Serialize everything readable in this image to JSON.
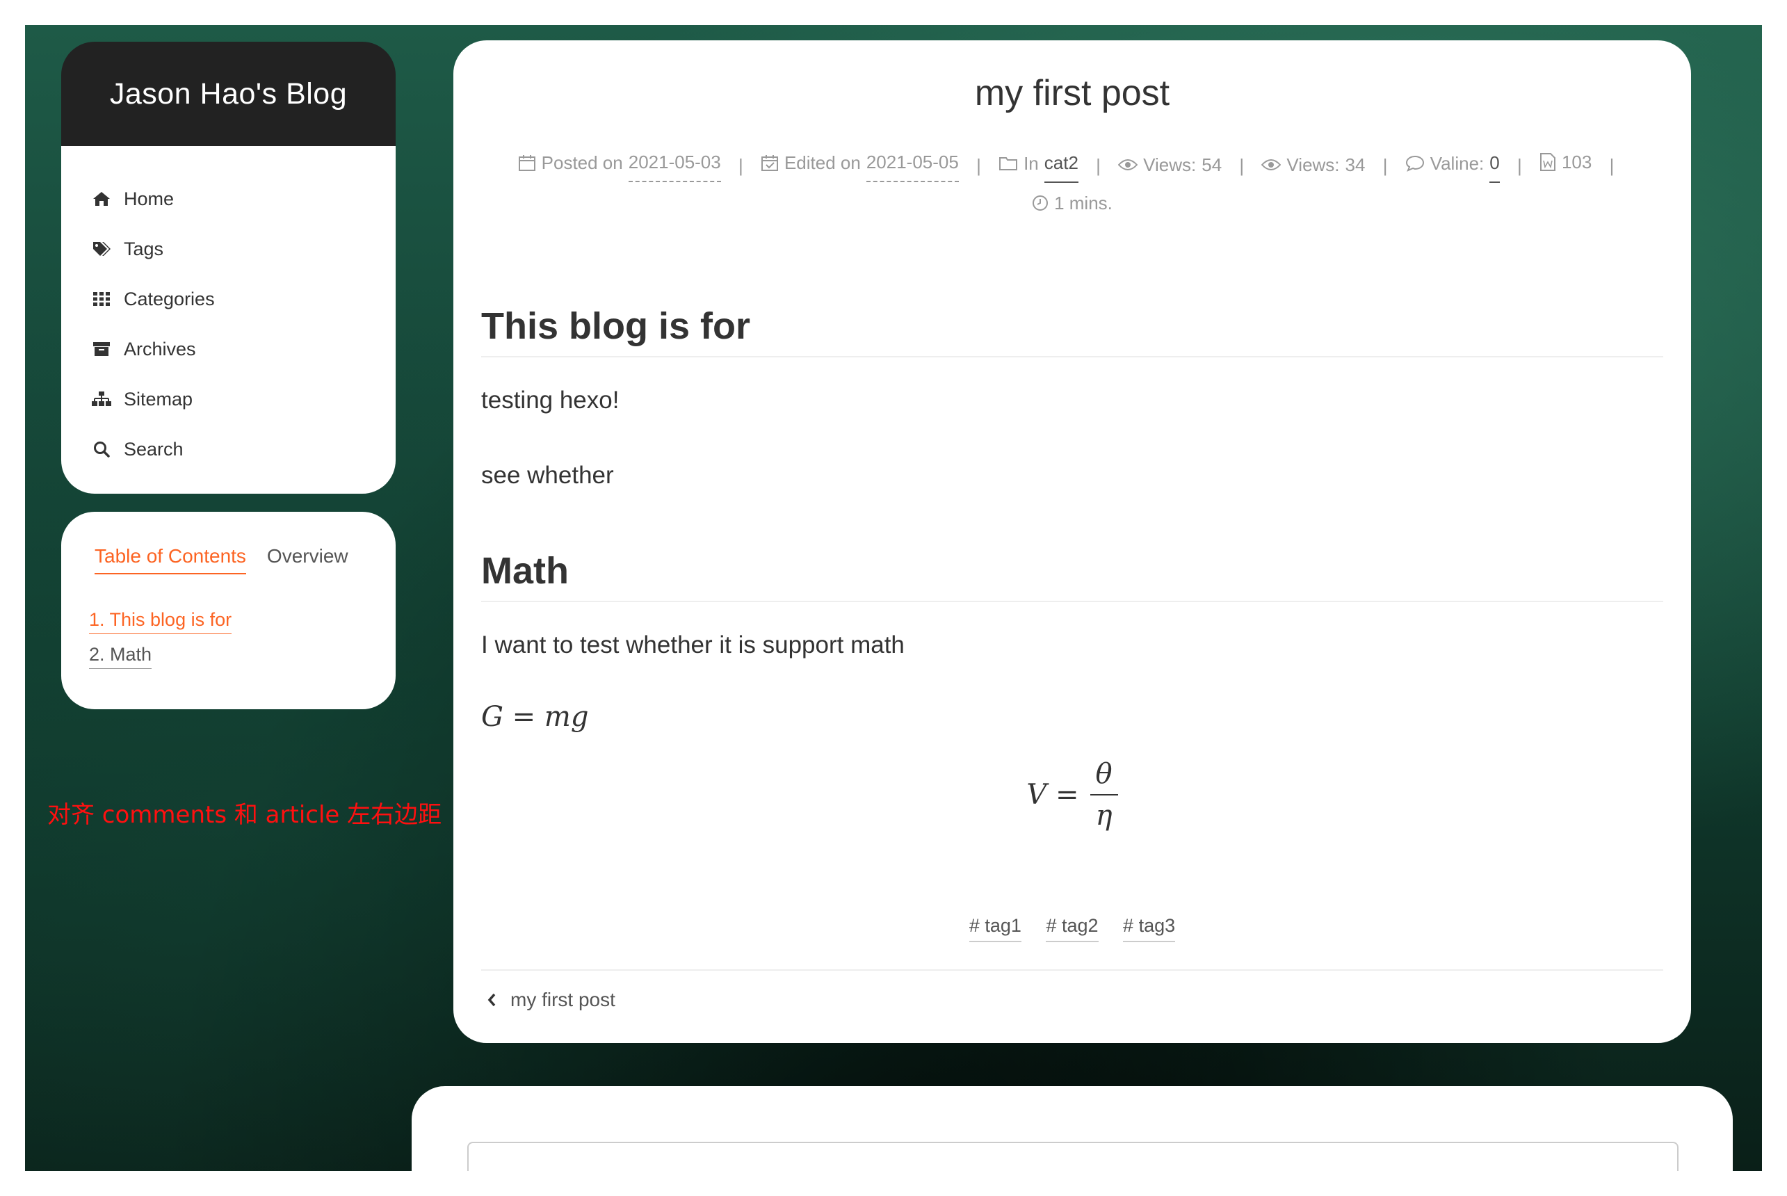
{
  "site": {
    "title": "Jason Hao's Blog"
  },
  "nav": [
    {
      "label": "Home",
      "icon": "home-icon"
    },
    {
      "label": "Tags",
      "icon": "tags-icon"
    },
    {
      "label": "Categories",
      "icon": "th-icon"
    },
    {
      "label": "Archives",
      "icon": "archive-icon"
    },
    {
      "label": "Sitemap",
      "icon": "sitemap-icon"
    },
    {
      "label": "Search",
      "icon": "search-icon"
    }
  ],
  "toc": {
    "tabs": {
      "toc": "Table of Contents",
      "overview": "Overview"
    },
    "items": [
      "1. This blog is for",
      "2. Math"
    ]
  },
  "annotation": "对齐 comments 和 article 左右边距",
  "post": {
    "title": "my first post",
    "meta": {
      "posted_label": "Posted on",
      "posted_date": "2021-05-03",
      "edited_label": "Edited on",
      "edited_date": "2021-05-05",
      "in_label": "In",
      "category": "cat2",
      "views1_label": "Views:",
      "views1": "54",
      "views2_label": "Views:",
      "views2": "34",
      "valine_label": "Valine:",
      "valine": "0",
      "words": "103",
      "reading_time": "1 mins.",
      "sep": "|"
    },
    "sections": {
      "h1": "This blog is for",
      "p1": "testing hexo!",
      "p2": "see whether",
      "h2": "Math",
      "p3": "I want to test whether it is support math",
      "inline_math": "G = mg",
      "display_lhs": "V =",
      "display_num": "θ",
      "display_den": "η"
    },
    "tags": [
      "# tag1",
      "# tag2",
      "# tag3"
    ],
    "prev_post": "my first post"
  },
  "colors": {
    "accent": "#fc6423",
    "annotation": "#ff1010",
    "header_bg": "#222222"
  }
}
